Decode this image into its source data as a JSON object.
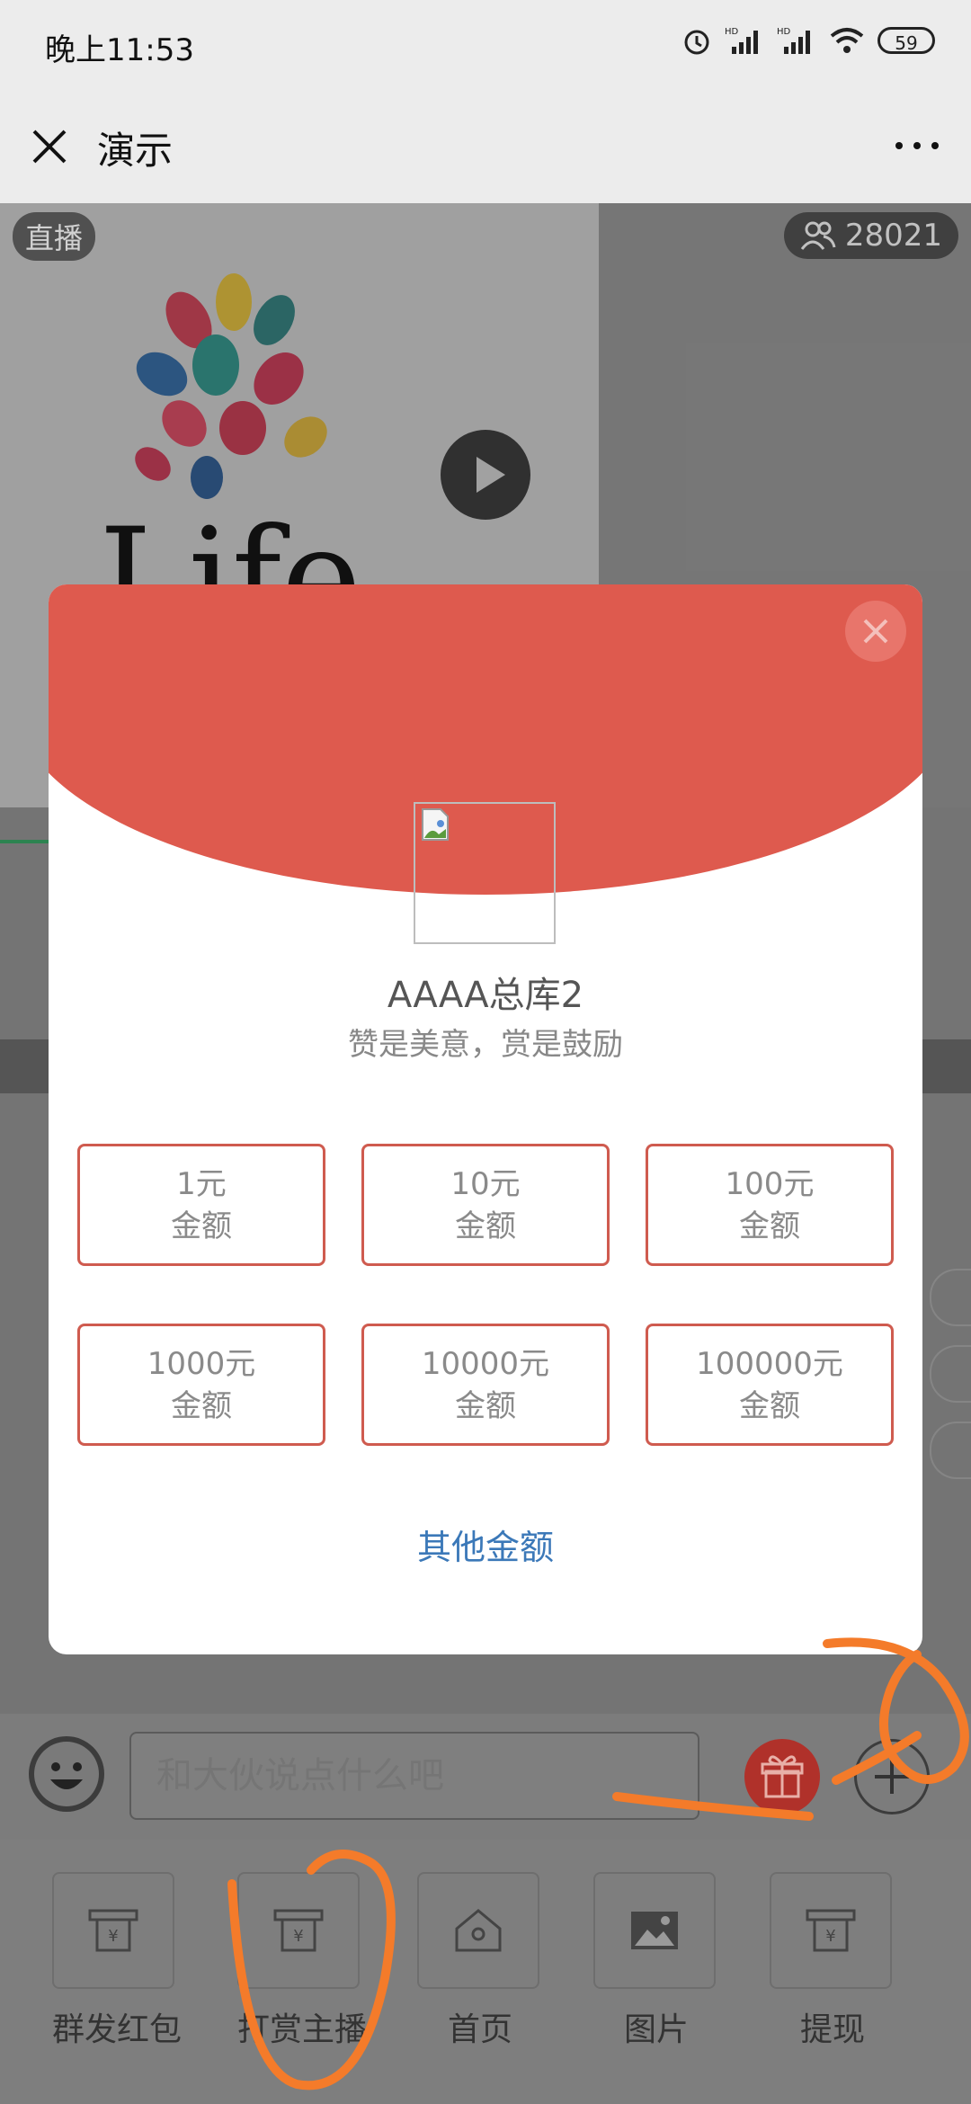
{
  "status_bar": {
    "time": "晚上11:53",
    "battery": "59"
  },
  "title_bar": {
    "title": "演示"
  },
  "live": {
    "badge": "直播",
    "viewer_count": "28021",
    "logo_text": "Life"
  },
  "reward_modal": {
    "anchor_name": "AAAA总库2",
    "slogan": "赞是美意，赏是鼓励",
    "amounts": [
      {
        "value": "1元",
        "label": "金额"
      },
      {
        "value": "10元",
        "label": "金额"
      },
      {
        "value": "100元",
        "label": "金额"
      },
      {
        "value": "1000元",
        "label": "金额"
      },
      {
        "value": "10000元",
        "label": "金额"
      },
      {
        "value": "100000元",
        "label": "金额"
      }
    ],
    "other_amount": "其他金额"
  },
  "chat": {
    "placeholder": "和大伙说点什么吧"
  },
  "menu": {
    "items": [
      {
        "label": "群发红包",
        "icon": "yen-card-icon"
      },
      {
        "label": "打赏主播",
        "icon": "yen-card-icon"
      },
      {
        "label": "首页",
        "icon": "home-icon"
      },
      {
        "label": "图片",
        "icon": "image-icon"
      },
      {
        "label": "提现",
        "icon": "yen-card-icon"
      }
    ]
  },
  "colors": {
    "accent": "#de5a4e",
    "link": "#3b78b8",
    "annotation": "#f47b2a"
  }
}
